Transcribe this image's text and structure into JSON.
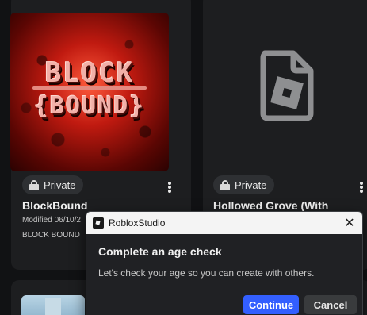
{
  "cards": [
    {
      "visibility": "Private",
      "title": "BlockBound",
      "modified": "Modified 06/10/2",
      "creator": "BLOCK BOUND",
      "thumbnail_logo_top": "BLOCK",
      "thumbnail_logo_bottom": "{BOUND}"
    },
    {
      "visibility": "Private",
      "title": "Hollowed Grove (With"
    }
  ],
  "dialog": {
    "app_name": "RobloxStudio",
    "close_glyph": "✕",
    "heading": "Complete an age check",
    "body": "Let's check your age so you can create with others.",
    "continue_label": "Continue",
    "cancel_label": "Cancel"
  },
  "colors": {
    "background": "#111214",
    "card": "#1d1e20",
    "pill": "#2e3033",
    "continue_button": "#335fff",
    "cancel_button": "#393b3d",
    "titlebar": "#f4f4f4"
  },
  "icons": {
    "lock": "lock-icon",
    "more": "more-vertical-icon",
    "placeholder": "roblox-file-icon",
    "close": "close-icon",
    "app": "roblox-studio-icon"
  }
}
